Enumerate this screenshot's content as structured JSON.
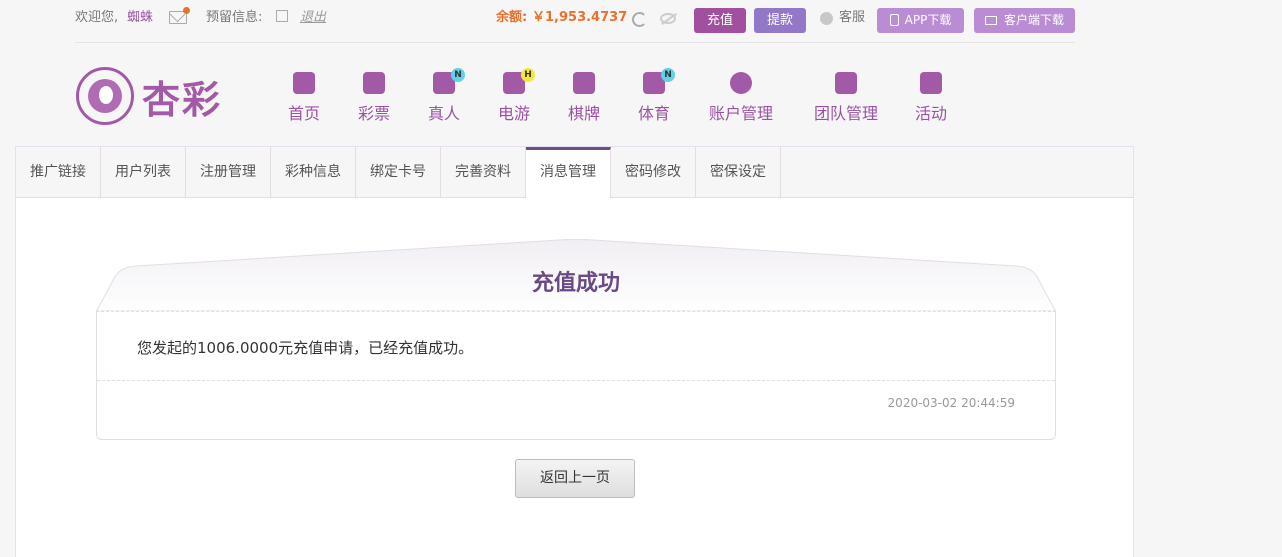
{
  "topbar": {
    "welcome": "欢迎您,",
    "username": "蜘蛛",
    "reserved_info": "预留信息:",
    "logout": "退出",
    "balance_label": "余额:",
    "balance": "￥1,953.4737",
    "recharge": "充值",
    "withdraw": "提款",
    "service": "客服",
    "app_download": "APP下载",
    "client_download": "客户端下载"
  },
  "logo": {
    "text": "杏彩"
  },
  "nav": [
    {
      "label": "首页",
      "icon": "home-icon"
    },
    {
      "label": "彩票",
      "icon": "ticket-icon"
    },
    {
      "label": "真人",
      "icon": "live-dealer-icon",
      "badge": "N"
    },
    {
      "label": "电游",
      "icon": "gamepad-icon",
      "badge": "H"
    },
    {
      "label": "棋牌",
      "icon": "cards-icon"
    },
    {
      "label": "体育",
      "icon": "trophy-icon",
      "badge": "N"
    },
    {
      "label": "账户管理",
      "icon": "account-icon"
    },
    {
      "label": "团队管理",
      "icon": "team-icon"
    },
    {
      "label": "活动",
      "icon": "gift-icon"
    }
  ],
  "tabs": [
    "推广链接",
    "用户列表",
    "注册管理",
    "彩种信息",
    "绑定卡号",
    "完善资料",
    "消息管理",
    "密码修改",
    "密保设定"
  ],
  "active_tab": "消息管理",
  "message": {
    "title": "充值成功",
    "body": "您发起的1006.0000元充值申请，已经充值成功。",
    "time": "2020-03-02 20:44:59"
  },
  "back_button": "返回上一页",
  "colors": {
    "brand": "#a35aa6",
    "balance": "#e8712f",
    "title": "#6a4a85"
  }
}
